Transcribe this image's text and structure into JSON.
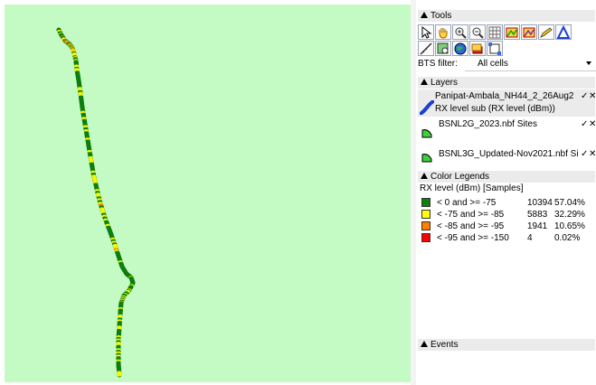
{
  "map": {
    "route_colors": {
      "good": "#0c7f0c",
      "fair": "#f7f700",
      "poor": "#ff8000",
      "bad": "#ff0000"
    }
  },
  "tools": {
    "header": "Tools",
    "buttons": [
      {
        "name": "select-arrow-icon"
      },
      {
        "name": "pan-hand-icon"
      },
      {
        "name": "zoom-in-icon"
      },
      {
        "name": "zoom-out-icon"
      },
      {
        "name": "grid-zoom-icon"
      },
      {
        "name": "map-green-icon"
      },
      {
        "name": "map-purple-icon"
      },
      {
        "name": "pencil-icon"
      },
      {
        "name": "triangle-icon"
      },
      {
        "name": "ruler-icon"
      },
      {
        "name": "search-map-icon"
      },
      {
        "name": "globe-icon"
      },
      {
        "name": "layers-stack-icon"
      },
      {
        "name": "resize-frame-icon"
      }
    ],
    "bts_filter_label": "BTS filter:",
    "bts_filter_value": "All cells"
  },
  "layers": {
    "header": "Layers",
    "items": [
      {
        "title": "Panipat-Ambala_NH44_2_26Aug2",
        "sub": "RX level sub (RX level (dBm))",
        "icon": "route-layer-icon",
        "check": "✓",
        "close": "✕"
      },
      {
        "title": "BSNL2G_2023.nbf Sites",
        "sub": "",
        "icon": "site-layer-icon",
        "check": "✓",
        "close": "✕"
      },
      {
        "title": "BSNL3G_Updated-Nov2021.nbf Si",
        "sub": "",
        "icon": "site-layer-icon",
        "check": "✓",
        "close": "✕"
      }
    ]
  },
  "legend": {
    "header": "Color Legends",
    "subtitle": "RX level (dBm) [Samples]",
    "rows": [
      {
        "label": "< 0 and >= -75",
        "count": "10394",
        "pct": "57.04%",
        "color": "#0c7f0c"
      },
      {
        "label": "< -75 and >= -85",
        "count": "5883",
        "pct": "32.29%",
        "color": "#ffff00"
      },
      {
        "label": "< -85 and >= -95",
        "count": "1941",
        "pct": "10.65%",
        "color": "#ff8000"
      },
      {
        "label": "< -95 and >= -150",
        "count": "4",
        "pct": "0.02%",
        "color": "#ff0000"
      }
    ]
  },
  "events": {
    "header": "Events"
  }
}
